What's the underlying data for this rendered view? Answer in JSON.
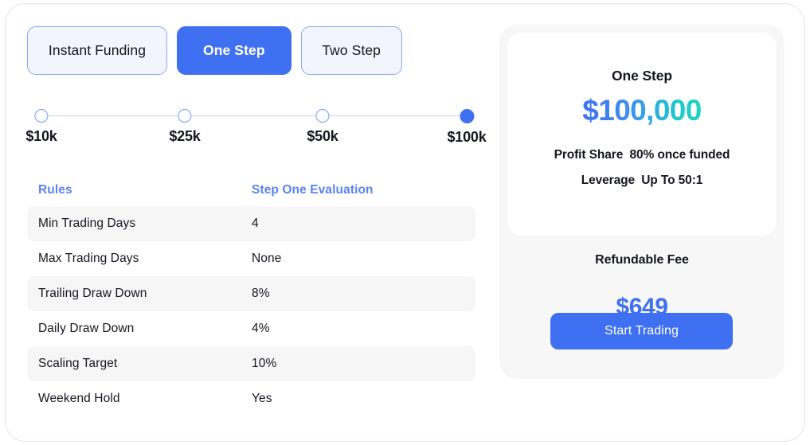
{
  "tabs": [
    {
      "label": "Instant Funding",
      "active": false
    },
    {
      "label": "One Step",
      "active": true
    },
    {
      "label": "Two Step",
      "active": false
    }
  ],
  "slider": {
    "stops": [
      {
        "label": "$10k",
        "selected": false
      },
      {
        "label": "$25k",
        "selected": false
      },
      {
        "label": "$50k",
        "selected": false
      },
      {
        "label": "$100k",
        "selected": true
      }
    ]
  },
  "table": {
    "headers": [
      "Rules",
      "Step One Evaluation"
    ],
    "rows": [
      {
        "rule": "Min Trading Days",
        "value": "4"
      },
      {
        "rule": "Max Trading Days",
        "value": "None"
      },
      {
        "rule": "Trailing Draw Down",
        "value": "8%"
      },
      {
        "rule": "Daily Draw Down",
        "value": "4%"
      },
      {
        "rule": "Scaling Target",
        "value": "10%"
      },
      {
        "rule": "Weekend Hold",
        "value": "Yes"
      }
    ]
  },
  "summary": {
    "plan_name": "One Step",
    "amount": "$100,000",
    "profit_share_key": "Profit Share",
    "profit_share_value": "80% once funded",
    "leverage_key": "Leverage",
    "leverage_value": "Up To 50:1",
    "fee_label": "Refundable Fee",
    "fee_amount": "$649",
    "cta_label": "Start Trading"
  },
  "colors": {
    "accent_blue": "#3f70f2",
    "header_blue": "#5b82f0",
    "amount_gradient_start": "#3f70f2",
    "amount_gradient_end": "#1ed6bd",
    "row_shade": "#f6f6f7",
    "panel_bg": "#f7f7f8",
    "frame_border": "#dfe6fb"
  }
}
